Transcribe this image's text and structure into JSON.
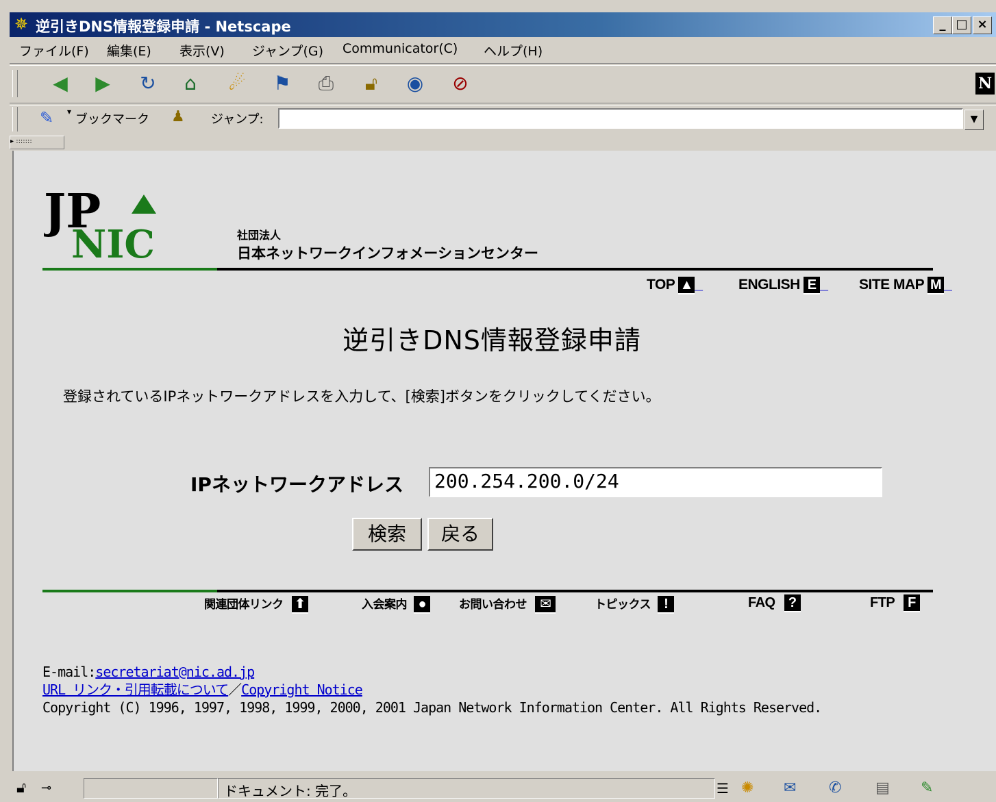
{
  "window": {
    "title": "逆引きDNS情報登録申請 - Netscape",
    "minimize": "_",
    "maximize": "□",
    "close": "×"
  },
  "menu": [
    "ファイル(F)",
    "編集(E)",
    "表示(V)",
    "ジャンプ(G)",
    "Communicator(C)",
    "ヘルプ(H)"
  ],
  "toolbar": {
    "icons": [
      "back-icon",
      "forward-icon",
      "reload-icon",
      "home-icon",
      "search-icon",
      "netscape-guide-icon",
      "print-icon",
      "security-icon",
      "shop-icon",
      "stop-icon"
    ],
    "brand": "N"
  },
  "location": {
    "bookmarks_label": "ブックマーク",
    "jump_label": "ジャンプ:",
    "url": ""
  },
  "site": {
    "org_type": "社団法人",
    "org_name": "日本ネットワークインフォメーションセンター",
    "logo_top": "JP",
    "logo_bottom": "NIC"
  },
  "topnav": [
    {
      "label": "TOP",
      "badge": "▲"
    },
    {
      "label": "ENGLISH",
      "badge": "E"
    },
    {
      "label": "SITE MAP",
      "badge": "M"
    }
  ],
  "page": {
    "title": "逆引きDNS情報登録申請",
    "instruction": "登録されているIPネットワークアドレスを入力して、[検索]ボタンをクリックしてください。",
    "ip_label": "IPネットワークアドレス",
    "ip_value": "200.254.200.0/24",
    "search_button": "検索",
    "back_button": "戻る"
  },
  "footnav": [
    {
      "label": "関連団体リンク",
      "badge": "⬆"
    },
    {
      "label": "入会案内",
      "badge": "●"
    },
    {
      "label": "お問い合わせ",
      "badge": "✉"
    },
    {
      "label": "トピックス",
      "badge": "!"
    },
    {
      "label": "FAQ",
      "badge": "?"
    },
    {
      "label": "FTP",
      "badge": "F"
    }
  ],
  "footer": {
    "email_prefix": "E-mail:",
    "email": "secretariat@nic.ad.jp",
    "link_policy": "URL リンク・引用転載について",
    "separator": "／",
    "copyright_notice": "Copyright Notice",
    "copyright": "Copyright (C) 1996, 1997, 1998, 1999, 2000, 2001 Japan Network Information Center. All Rights Reserved."
  },
  "status": {
    "text": "ドキュメント: 完了。"
  }
}
